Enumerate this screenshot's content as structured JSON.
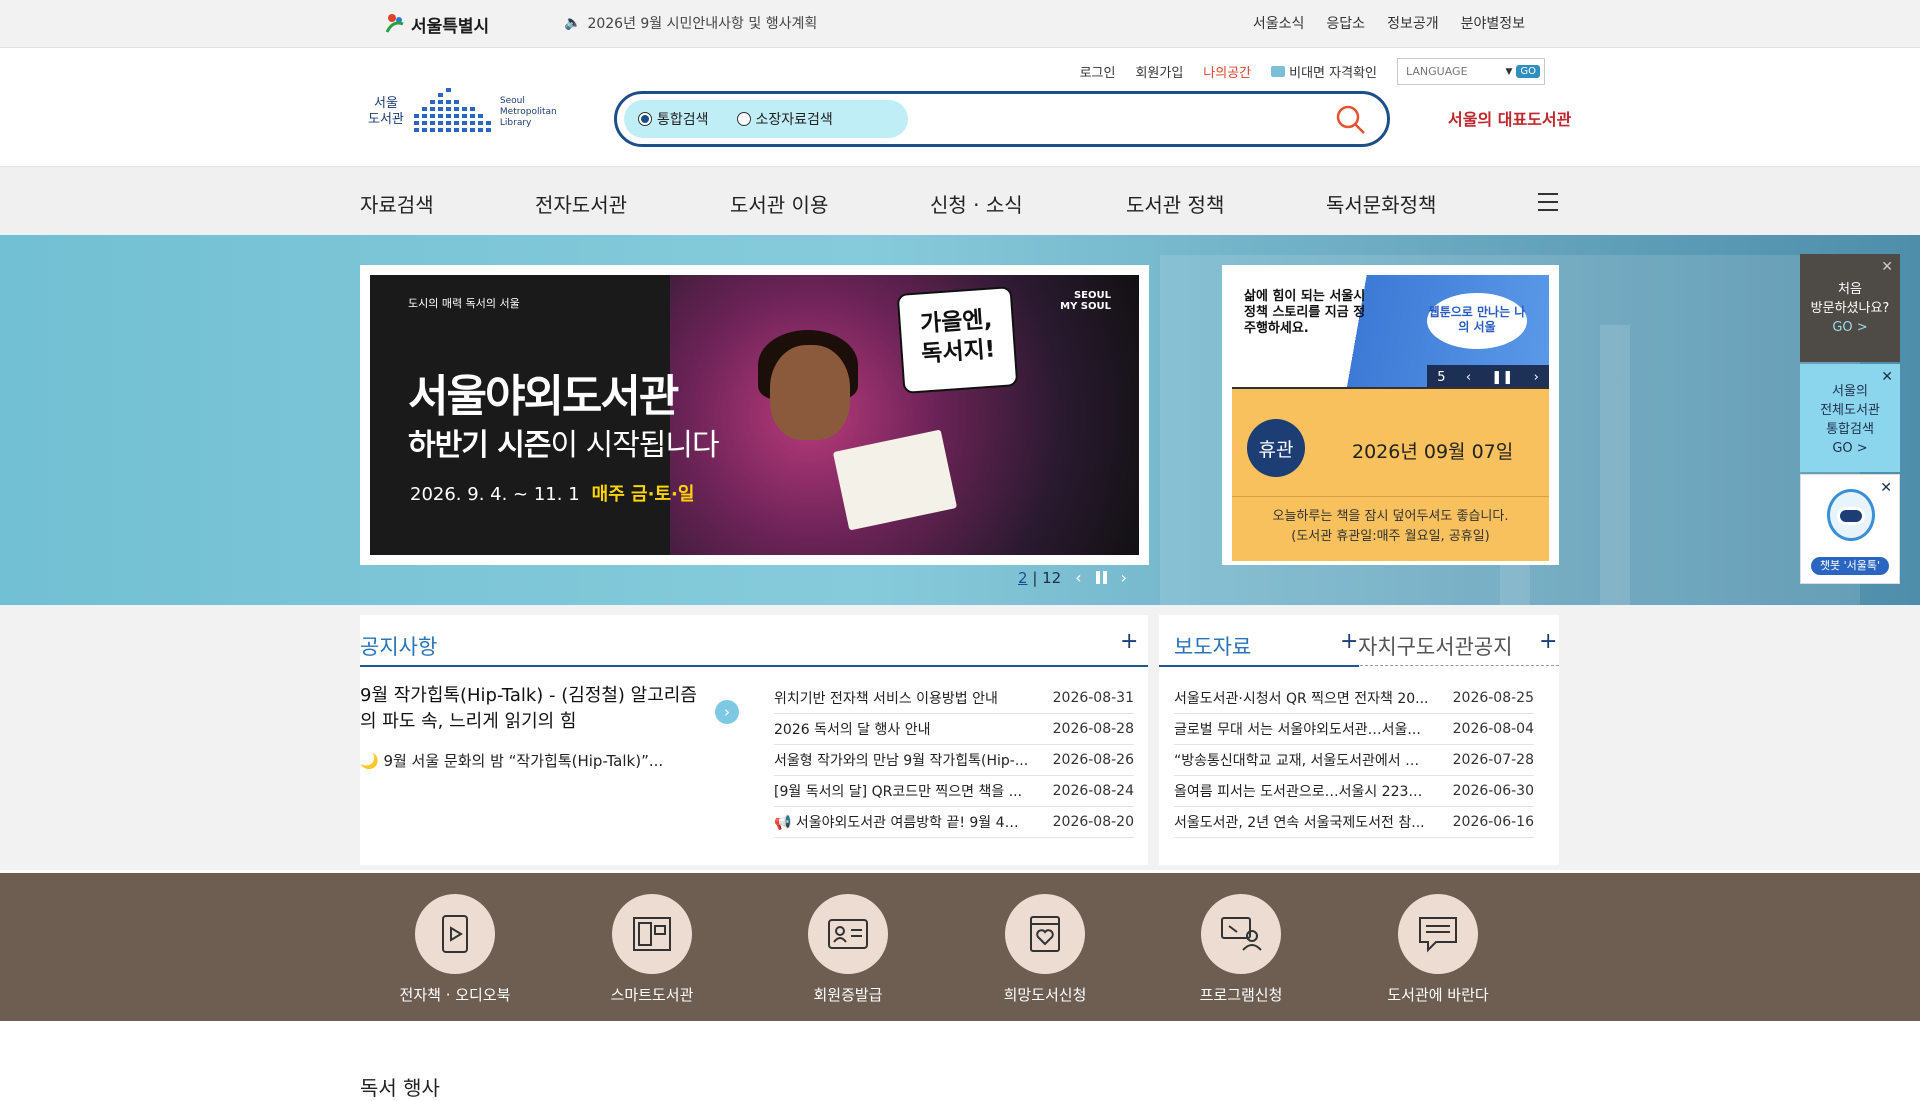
{
  "topbar": {
    "seoul_logo": "서울특별시",
    "notice": "2026년 9월 시민안내사항 및 행사계획",
    "links": [
      "서울소식",
      "응답소",
      "정보공개",
      "분야별정보"
    ]
  },
  "util": {
    "login": "로그인",
    "join": "회원가입",
    "mine": "나의공간",
    "verify": "비대면 자격확인",
    "language": "LANGUAGE",
    "go": "GO"
  },
  "logo": {
    "kr_line1": "서울",
    "kr_line2": "도서관",
    "en_line1": "Seoul",
    "en_line2": "Metropolitan",
    "en_line3": "Library",
    "rep": "서울의 대표도서관"
  },
  "search": {
    "options": [
      "통합검색",
      "소장자료검색"
    ],
    "selected": "통합검색",
    "value": ""
  },
  "gnb": [
    "자료검색",
    "전자도서관",
    "도서관 이용",
    "신청 · 소식",
    "도서관 정책",
    "독서문화정책"
  ],
  "banner": {
    "small_text": "도시의 매력 독서의 서울",
    "title": "서울야외도서관",
    "sub_bold": "하반기 시즌",
    "sub_rest": "이 시작됩니다",
    "date": "2026. 9. 4. ~ 11. 1",
    "days": "매주 금·토·일",
    "bubble_line1": "가을엔,",
    "bubble_line2": "독서지!",
    "brand_line1": "SEOUL",
    "brand_line2": "MY SOUL",
    "current": "2",
    "total": "12"
  },
  "closed": {
    "promo_text": "삶에 힘이 되는 서울시 정책 스토리를 지금 정주행하세요.",
    "promo_bubble": "웹툰으로 만나는 나의 서울",
    "promo_counter": "5",
    "badge": "휴관",
    "date": "2026년 09월 07일",
    "msg_line1": "오늘하루는 책을 잠시 덮어두셔도 좋습니다.",
    "msg_line2": "(도서관 휴관일:매주 월요일, 공휴일)"
  },
  "quick": {
    "first_visit_line1": "처음",
    "first_visit_line2": "방문하셨나요?",
    "first_visit_go": "GO  >",
    "search_line1": "서울의",
    "search_line2": "전체도서관",
    "search_line3": "통합검색",
    "search_go": "GO  >",
    "chatbot": "챗봇 '서울톡'"
  },
  "notice": {
    "title": "공지사항",
    "featured_title": "9월 작가힙톡(Hip-Talk) - (김정철) 알고리즘의 파도 속, 느리게 읽기의 힘",
    "featured_sub": "🌙 9월 서울 문화의 밤 “작가힙톡(Hip-Talk)”...",
    "items": [
      {
        "title": "위치기반 전자책 서비스 이용방법 안내",
        "date": "2026-08-31"
      },
      {
        "title": "2026 독서의 달 행사 안내",
        "date": "2026-08-28"
      },
      {
        "title": "서울형 작가와의 만남 9월 작가힙톡(Hip-...",
        "date": "2026-08-26"
      },
      {
        "title": "[9월 독서의 달] QR코드만 찍으면 책을 ...",
        "date": "2026-08-24"
      },
      {
        "title": "📢 서울야외도서관 여름방학 끝! 9월 4일...",
        "date": "2026-08-20"
      }
    ]
  },
  "press": {
    "title": "보도자료",
    "title2": "자치구도서관공지",
    "items": [
      {
        "title": "서울도서관·시청서 QR 찍으면 전자책 20...",
        "date": "2026-08-25"
      },
      {
        "title": "글로벌 무대 서는 서울야외도서관…서울...",
        "date": "2026-08-04"
      },
      {
        "title": "“방송통신대학교 교재, 서울도서관에서 빌...",
        "date": "2026-07-28"
      },
      {
        "title": "올여름 피서는 도서관으로…서울시 223개...",
        "date": "2026-06-30"
      },
      {
        "title": "서울도서관, 2년 연속 서울국제도서전 참...",
        "date": "2026-06-16"
      }
    ]
  },
  "services": [
    "전자책 · 오디오북",
    "스마트도서관",
    "회원증발급",
    "희망도서신청",
    "프로그램신청",
    "도서관에 바란다"
  ],
  "bottom_title": "독서 행사",
  "colors": {
    "primary": "#1c4e8a",
    "accent_blue": "#2a75b8",
    "hero_bg": "#7fc4d6",
    "services_bg": "#6e5e52",
    "closed_bg": "#f8c15d"
  }
}
